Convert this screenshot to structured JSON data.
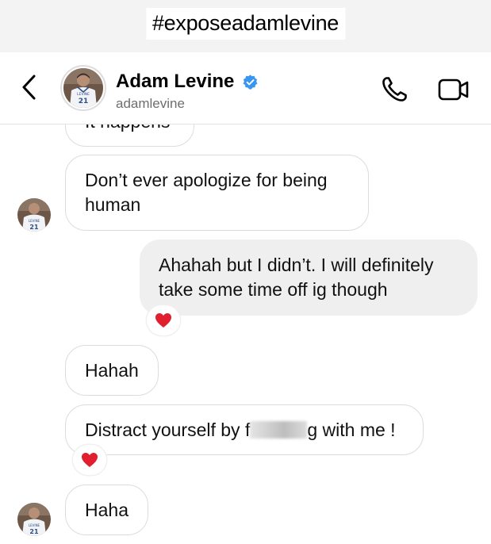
{
  "caption": {
    "hashtag": "#exposeadamlevine"
  },
  "header": {
    "name": "Adam Levine",
    "username": "adamlevine",
    "verified": true,
    "avatar_jersey_text": "LEVINE",
    "avatar_jersey_number": "21"
  },
  "messages": {
    "m0": {
      "text": "It happens"
    },
    "m1": {
      "line1": "Don’t ever apologize for being",
      "line2": "human"
    },
    "m2": {
      "line1": "Ahahah but I didn’t. I will definitely",
      "line2": "take some time off ig though",
      "reaction": "heart"
    },
    "m3": {
      "text": "Hahah"
    },
    "m4": {
      "before": "Distract yourself by f",
      "after": "g with me !",
      "redacted": true,
      "reaction": "heart"
    },
    "m5": {
      "text": "Haha"
    }
  },
  "colors": {
    "incoming_bubble": "#ffffff",
    "outgoing_bubble": "#efefef",
    "verified_badge": "#3797f0",
    "heart": "#e0202f"
  }
}
